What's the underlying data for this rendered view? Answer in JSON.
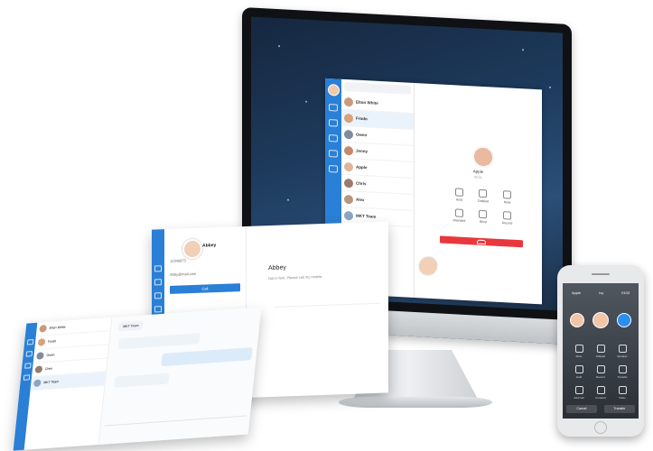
{
  "desktop_app": {
    "contacts": [
      {
        "name": "Elton White",
        "msg": "",
        "time": "",
        "color": "#c99b7d"
      },
      {
        "name": "Frodo",
        "msg": "",
        "time": "",
        "color": "#d9a07c"
      },
      {
        "name": "Owen",
        "msg": "",
        "time": "",
        "color": "#7f8c9b"
      },
      {
        "name": "Jenny",
        "msg": "",
        "time": "",
        "color": "#c48a6e"
      },
      {
        "name": "Apple",
        "msg": "",
        "time": "",
        "color": "#e2b598"
      },
      {
        "name": "Chris",
        "msg": "",
        "time": "",
        "color": "#9a7a6a"
      },
      {
        "name": "Alex",
        "msg": "",
        "time": "",
        "color": "#b7977f"
      },
      {
        "name": "MKT Team",
        "msg": "",
        "time": "",
        "color": "#8ba5c4"
      }
    ],
    "call": {
      "name": "Apple",
      "duration": "00:01",
      "controls": [
        "Hold",
        "Dialpad",
        "Mute",
        "Attended",
        "Blind",
        "Record"
      ]
    }
  },
  "profile_panel": {
    "name": "Abbey",
    "phone": "12345673",
    "email": "Abby@mail.com",
    "call_label": "Call",
    "header_name": "Abbey",
    "header_sub": "Not in font. Please call my mobile."
  },
  "chat_panel": {
    "contacts": [
      {
        "name": "Elton White",
        "color": "#c99b7d"
      },
      {
        "name": "Frodo",
        "color": "#d9a07c"
      },
      {
        "name": "Owen",
        "color": "#7f8c9b"
      },
      {
        "name": "Chris",
        "color": "#9a7a6a"
      },
      {
        "name": "MKT Team",
        "color": "#8ba5c4"
      }
    ],
    "chat_title": "MKT Team"
  },
  "phone": {
    "top": [
      "Apple",
      "Ivy",
      "0103"
    ],
    "buttons": [
      "Mute",
      "Dialpad",
      "Speaker",
      "Hold",
      "Record",
      "Transfer",
      "Add Call",
      "Contacts",
      "Video"
    ],
    "bottom": [
      "Cancel",
      "Transfer"
    ]
  }
}
